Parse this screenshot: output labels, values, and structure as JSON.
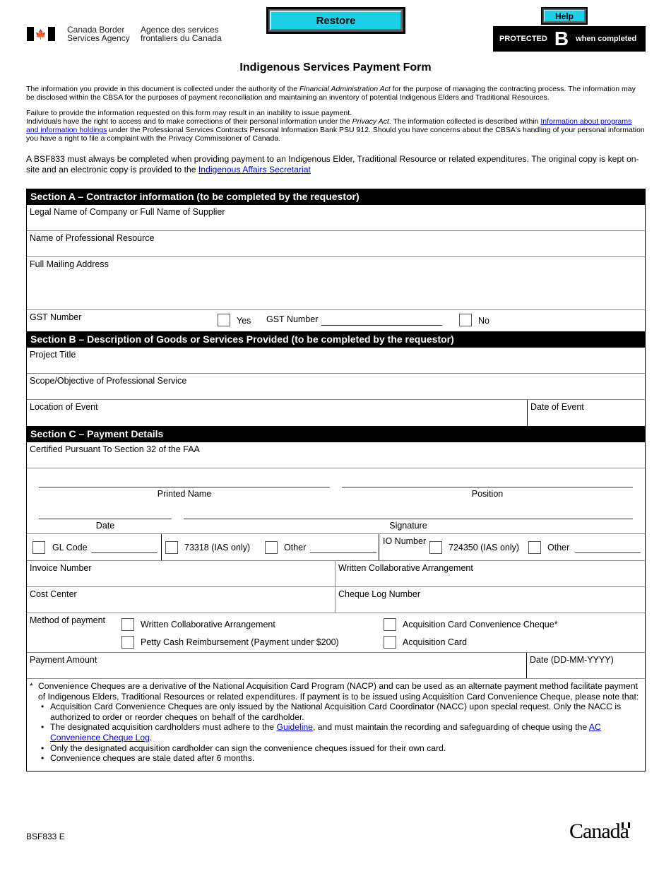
{
  "header": {
    "agency_en_line1": "Canada Border",
    "agency_en_line2": "Services Agency",
    "agency_fr_line1": "Agence des services",
    "agency_fr_line2": "frontaliers du Canada",
    "restore_label": "Restore",
    "help_label": "Help",
    "protected": {
      "prefix": "PROTECTED",
      "level": "B",
      "suffix": "when completed"
    }
  },
  "title": "Indigenous Services Payment Form",
  "intro": {
    "p1_a": "The information you provide in this document is collected under the authority of the ",
    "p1_italic": "Financial Administration Act",
    "p1_b": " for the purpose of managing the contracting process. The information may be disclosed within the CBSA for the purposes of payment reconciliation and maintaining an inventory of potential Indigenous Elders and Traditional Resources.",
    "p2": "Failure to provide the information requested on this form may result in an inability to issue payment.",
    "p3_a": "Individuals have the right to access and to make corrections of their personal information under the ",
    "p3_italic": "Privacy Act",
    "p3_b": ". The information collected is described within ",
    "p3_link": "Information about programs and information holdings",
    "p3_c": " under the Professional Services Contracts Personal Information Bank PSU 912. Should you have concerns about the CBSA's handling of your personal information you have a right to file a complaint with the Privacy Commissioner of Canada.",
    "bsf_a": "A BSF833 must always be completed when providing payment to an Indigenous Elder, Traditional Resource or related expenditures. The original copy is kept on-site and an electronic copy is provided to the ",
    "bsf_link": "Indigenous Affairs Secretariat"
  },
  "section_a": {
    "heading": "Section A – Contractor information (to be completed by the requestor)",
    "legal_name": "Legal Name of Company or Full Name of Supplier",
    "resource_name": "Name of Professional Resource",
    "mailing_address": "Full Mailing Address",
    "gst_label": "GST Number",
    "gst_yes": "Yes",
    "gst_number_label": "GST Number",
    "gst_no": "No"
  },
  "section_b": {
    "heading": "Section B – Description of Goods or Services Provided (to be completed by the requestor)",
    "project_title": "Project Title",
    "scope": "Scope/Objective of Professional Service",
    "location": "Location of Event",
    "date_of_event": "Date of Event"
  },
  "section_c": {
    "heading": "Section C – Payment Details",
    "certified": "Certified Pursuant To Section 32 of the FAA",
    "printed_name": "Printed Name",
    "position": "Position",
    "date": "Date",
    "signature": "Signature",
    "gl_code": "GL Code",
    "gl_73318": "73318 (IAS only)",
    "gl_other": "Other",
    "io_number": "IO Number",
    "io_724350": "724350 (IAS only)",
    "io_other": "Other",
    "invoice_number": "Invoice Number",
    "written_collab": "Written Collaborative Arrangement",
    "cost_center": "Cost Center",
    "cheque_log": "Cheque Log Number",
    "method_label": "Method of payment",
    "methods": [
      "Written Collaborative Arrangement",
      "Acquisition Card Convenience Cheque*",
      "Petty Cash Reimbursement (Payment under $200)",
      "Acquisition Card"
    ],
    "payment_amount": "Payment Amount",
    "payment_date": "Date (DD-MM-YYYY)"
  },
  "notes": {
    "star": "*",
    "intro": "Convenience Cheques are a derivative of the National Acquisition Card Program (NACP) and can be used as an alternate payment method facilitate payment of Indigenous Elders, Traditional Resources or related expenditures. If payment is to be issued using Acquisition Card Convenience Cheque, please note that:",
    "bullet1": "Acquisition Card Convenience Cheques are only issued by the National Acquisition Card Coordinator (NACC) upon special request. Only the NACC is authorized to order or reorder cheques on behalf of the cardholder.",
    "bullet2_a": "The designated acquisition cardholders must adhere to the ",
    "bullet2_link1": "Guideline",
    "bullet2_b": ", and must maintain the recording and safeguarding of cheque using the ",
    "bullet2_link2": "AC Convenience Cheque Log",
    "bullet2_c": ".",
    "bullet3": "Only the designated acquisition cardholder can sign the convenience cheques issued for their own card.",
    "bullet4": "Convenience cheques are stale dated after 6 months.",
    "bullet_glyph": "•"
  },
  "footer": {
    "form_code": "BSF833 E",
    "wordmark": "Canada"
  }
}
